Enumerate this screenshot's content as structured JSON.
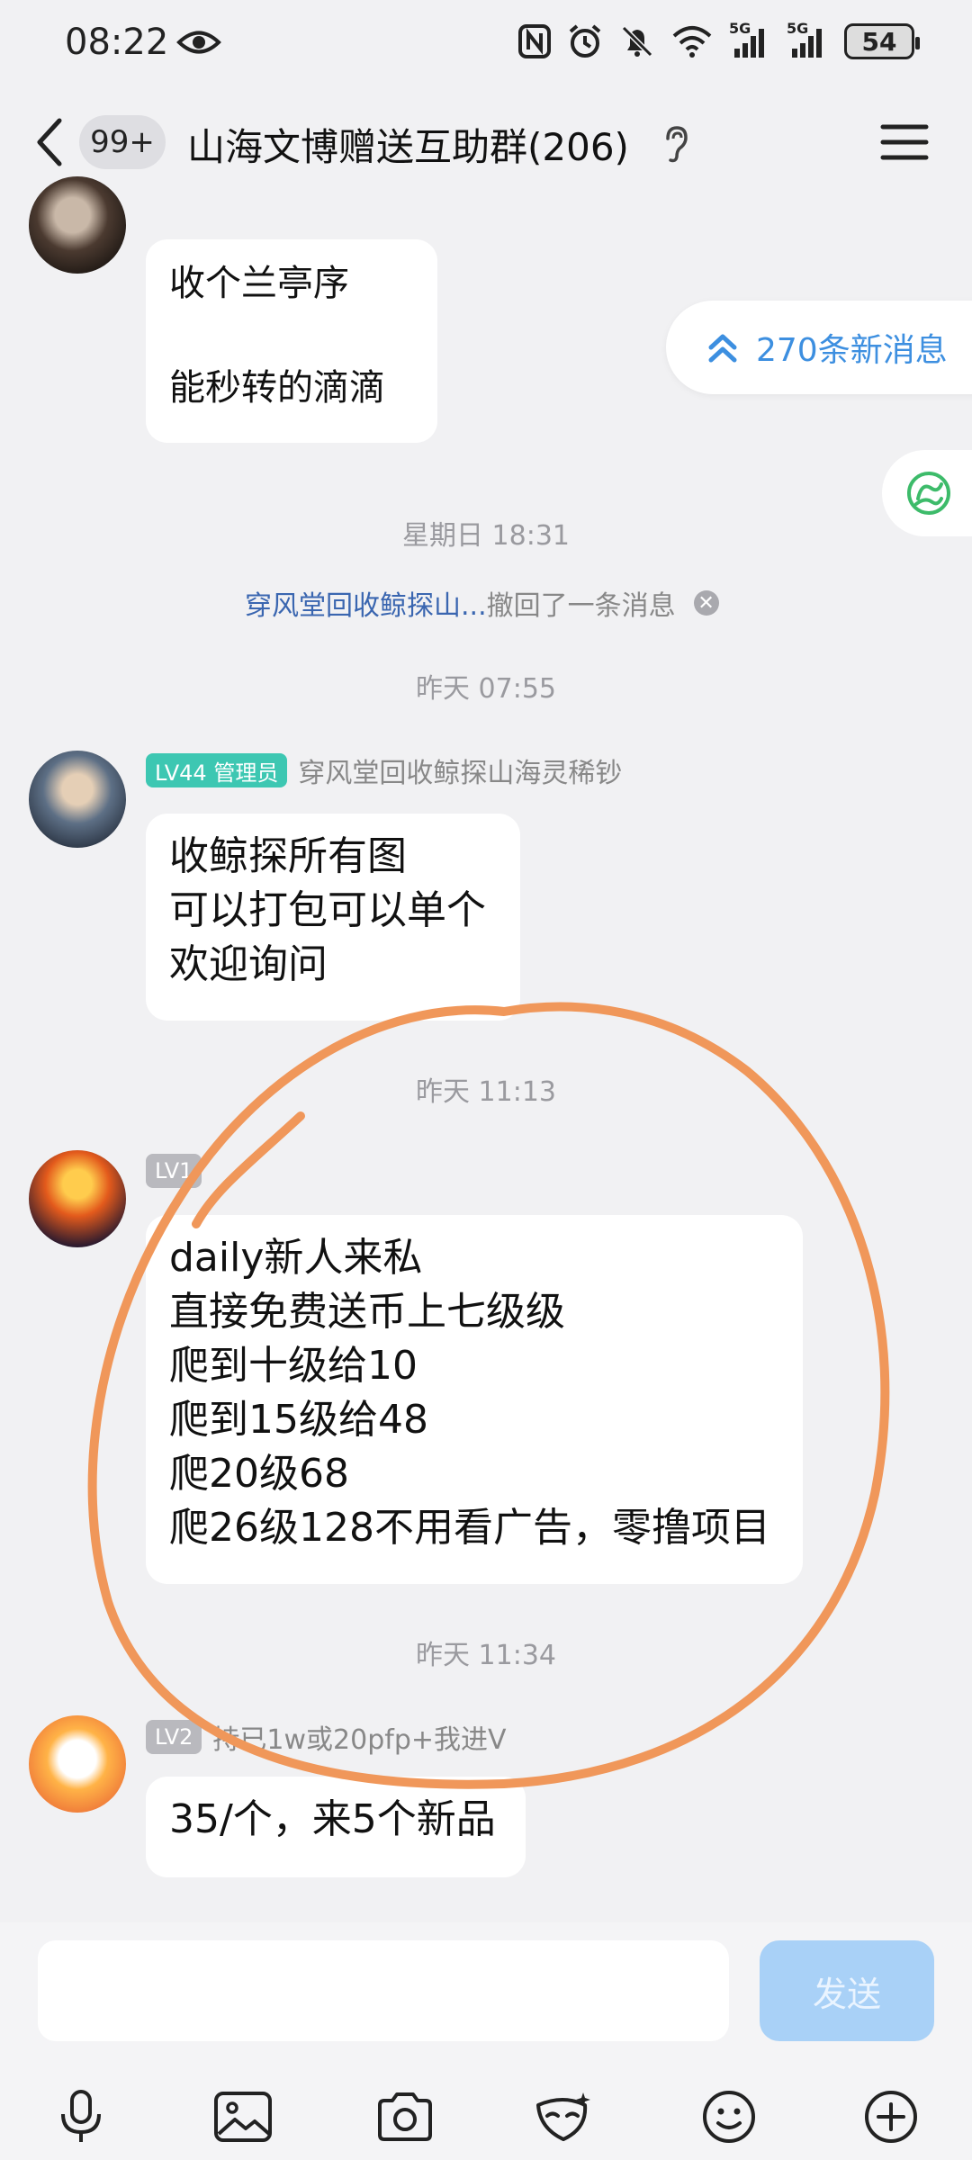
{
  "status_bar": {
    "time": "08:22",
    "battery": "54",
    "signal_label_1": "5G",
    "signal_label_2": "5G"
  },
  "header": {
    "unread_badge": "99+",
    "title": "山海文博赠送互助群(206)"
  },
  "new_messages": {
    "label": "270条新消息"
  },
  "messages": [
    {
      "level": "",
      "sender": "",
      "lines": [
        "收个兰亭序",
        "能秒转的滴滴"
      ]
    },
    {
      "level": "LV44 管理员",
      "sender": "穿风堂回收鲸探山海灵稀钞",
      "lines": [
        "收鲸探所有图",
        "可以打包可以单个",
        "欢迎询问"
      ]
    },
    {
      "level": "LV1",
      "sender": "",
      "lines": [
        "daily新人来私",
        "直接免费送币上七级级",
        "爬到十级给10",
        "爬到15级给48",
        "爬20级68",
        "爬26级128不用看广告，零撸项目"
      ]
    },
    {
      "level": "LV2",
      "sender": "持已1w或20pfp+我进V",
      "lines": [
        "35/个，来5个新品"
      ]
    }
  ],
  "timestamps": [
    "星期日 18:31",
    "昨天 07:55",
    "昨天 11:13",
    "昨天 11:34"
  ],
  "recall_notice": {
    "who": "穿风堂回收鲸探山...",
    "text": "撤回了一条消息"
  },
  "input": {
    "value": "",
    "placeholder": "",
    "send_label": "发送"
  },
  "colors": {
    "accent": "#3d8fe0",
    "admin_badge": "#3dc7b2",
    "annotation": "#f0975a",
    "send_disabled": "#a9d1f7"
  },
  "icons": [
    "eye-icon",
    "nfc-icon",
    "alarm-icon",
    "mute-icon",
    "wifi-icon",
    "signal-icon",
    "back-icon",
    "ear-icon",
    "menu-icon",
    "double-chevron-up-icon",
    "app-float-icon",
    "mic-icon",
    "image-icon",
    "camera-icon",
    "mask-icon",
    "emoji-icon",
    "plus-icon"
  ]
}
